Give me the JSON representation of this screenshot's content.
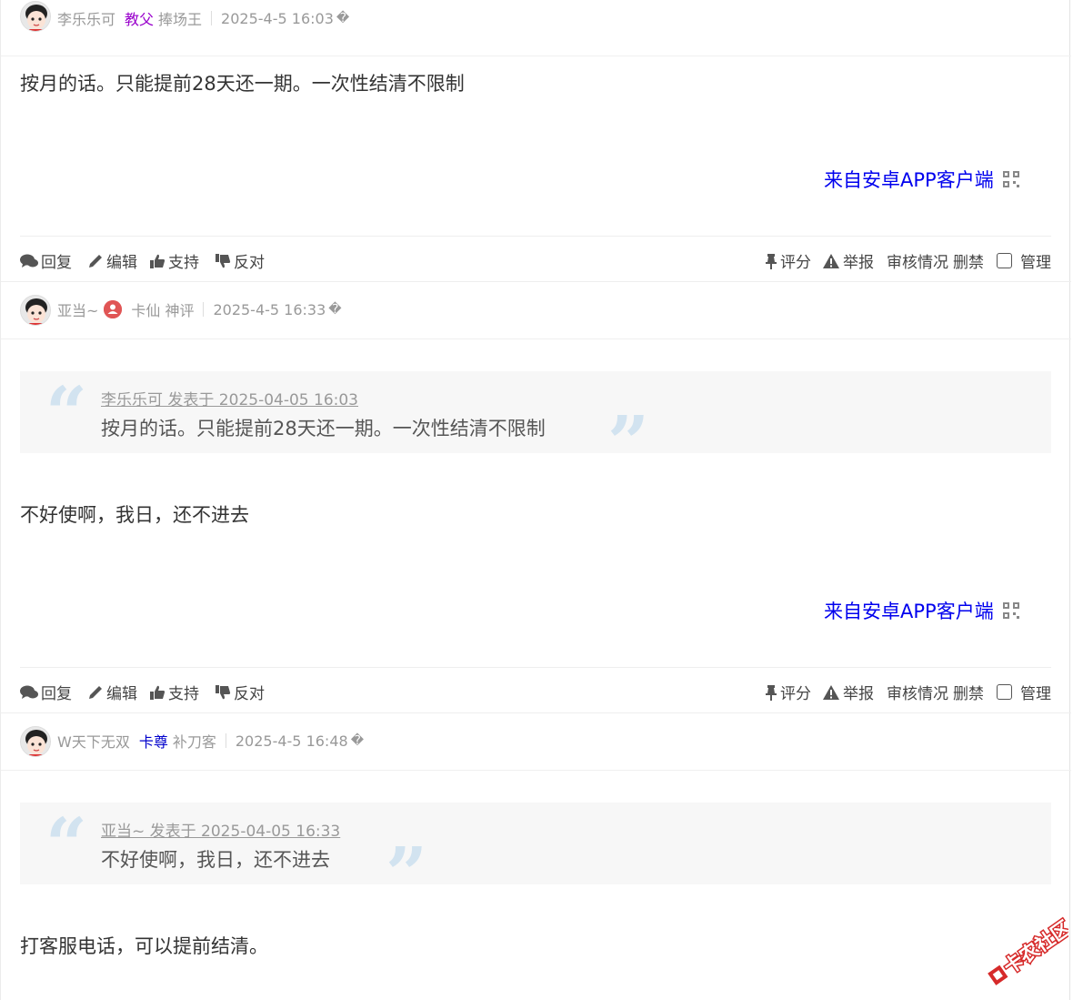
{
  "posts": [
    {
      "username": "李乐乐可",
      "group": "教父",
      "group_color": "#9900cc",
      "title": "捧场王",
      "time": "2025-4-5 16:03",
      "q": "�",
      "content": "按月的话。只能提前28天还一期。一次性结清不限制",
      "from_app": "来自安卓APP客户端"
    },
    {
      "username": "亚当~",
      "group": "卡仙",
      "group_color": "#999999",
      "title": "神评",
      "time": "2025-4-5 16:33",
      "q": "�",
      "quote_meta": "李乐乐可 发表于 2025-04-05 16:03",
      "quote_text": "按月的话。只能提前28天还一期。一次性结清不限制",
      "content": "不好使啊，我日，还不进去",
      "from_app": "来自安卓APP客户端"
    },
    {
      "username": "W天下无双",
      "group": "卡尊",
      "group_color": "#0000cc",
      "title": "补刀客",
      "time": "2025-4-5 16:48",
      "q": "�",
      "quote_meta": "亚当~ 发表于 2025-04-05 16:33",
      "quote_text": "不好使啊，我日，还不进去",
      "content": "打客服电话，可以提前结清。"
    }
  ],
  "actions": {
    "reply": "回复",
    "edit": "编辑",
    "support": "支持",
    "oppose": "反对",
    "rate": "评分",
    "report": "举报",
    "audit": "审核情况",
    "ban": "删禁",
    "manage": "管理"
  },
  "watermark": "卡农社区"
}
